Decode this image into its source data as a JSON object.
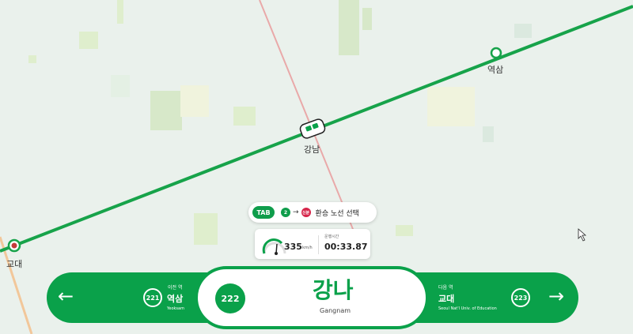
{
  "map": {
    "stations": [
      {
        "id": "yeoksam",
        "label": "역삼"
      },
      {
        "id": "gangnam",
        "label": "강남"
      },
      {
        "id": "gyodae",
        "label": "교대"
      }
    ],
    "line_color": "#17a34a",
    "railway_color": "#e9a9a9"
  },
  "hint": {
    "key": "TAB",
    "line_badge": "2",
    "arrow": "→",
    "shinbundang_badge": "신분",
    "text": "환승 노선 선택"
  },
  "speedometer": {
    "value": "335",
    "unit": "km/h",
    "time_label": "운행시간",
    "time": "00:33.87"
  },
  "bottom_bar": {
    "prev": {
      "label": "이전 역",
      "number": "221",
      "name": "역삼",
      "name_en": "Yeoksam",
      "arrow": "←"
    },
    "current": {
      "number": "222",
      "name": "강나",
      "name_en": "Gangnam"
    },
    "next": {
      "label": "다음 역",
      "number": "223",
      "name": "교대",
      "name_en": "Seoul Nat'l Univ. of Education",
      "arrow": "→"
    }
  },
  "colors": {
    "accent": "#0aa14a",
    "map_bg": "#eaf1ec"
  }
}
